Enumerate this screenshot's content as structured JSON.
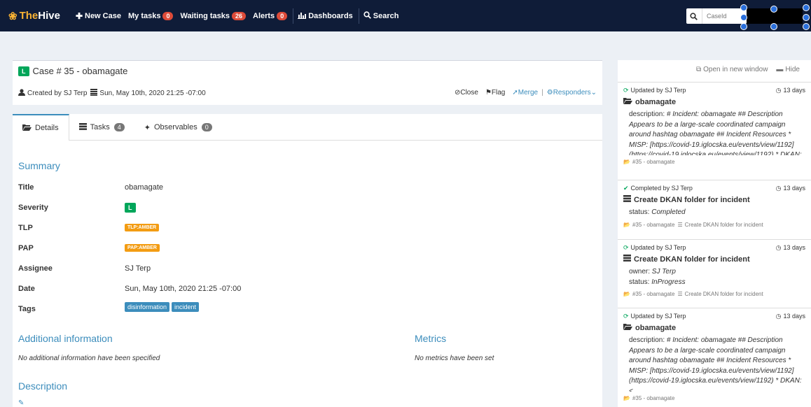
{
  "nav": {
    "brand_part1": "The",
    "brand_part2": "Hive",
    "new_case": "New Case",
    "my_tasks": "My tasks",
    "my_tasks_count": "0",
    "waiting_tasks": "Waiting tasks",
    "waiting_tasks_count": "26",
    "alerts": "Alerts",
    "alerts_count": "0",
    "dashboards": "Dashboards",
    "search": "Search",
    "search_placeholder": "CaseId"
  },
  "case": {
    "severity_badge": "L",
    "title": "Case # 35 - obamagate",
    "created_by": "Created by SJ Terp",
    "created_date": "Sun, May 10th, 2020 21:25 -07:00",
    "action_close": "Close",
    "action_flag": "Flag",
    "action_merge": "Merge",
    "action_responders": "Responders"
  },
  "tabs": [
    {
      "label": "Details"
    },
    {
      "label": "Tasks",
      "count": "4"
    },
    {
      "label": "Observables",
      "count": "0"
    }
  ],
  "summary": {
    "heading": "Summary",
    "title_label": "Title",
    "title_value": "obamagate",
    "severity_label": "Severity",
    "severity_value": "L",
    "tlp_label": "TLP",
    "tlp_value": "TLP:AMBER",
    "pap_label": "PAP",
    "pap_value": "PAP:AMBER",
    "assignee_label": "Assignee",
    "assignee_value": "SJ Terp",
    "date_label": "Date",
    "date_value": "Sun, May 10th, 2020 21:25 -07:00",
    "tags_label": "Tags",
    "tags": [
      "disinformation",
      "incident"
    ]
  },
  "additional": {
    "heading": "Additional information",
    "note": "No additional information have been specified"
  },
  "metrics": {
    "heading": "Metrics",
    "note": "No metrics have been set"
  },
  "description": {
    "heading": "Description"
  },
  "side": {
    "open_window": "Open in new window",
    "hide": "Hide",
    "items": [
      {
        "actor": "Updated by SJ Terp",
        "age": "13 days",
        "title": "obamagate",
        "field1_label": "description:",
        "field1_value": "# Incident: obamagate ## Description Appears to be a large-scale coordinated campaign around hashtag obamagate ## Incident Resources * MISP: [https://covid-19.iglocska.eu/events/view/1192](https://covid-19.iglocska.eu/events/view/1192) * DKAN: [",
        "foot": "#35 - obamagate"
      },
      {
        "actor": "Completed by SJ Terp",
        "age": "13 days",
        "title": "Create DKAN folder for incident",
        "field1_label": "status:",
        "field1_value": "Completed",
        "foot": "#35 - obamagate",
        "foot_task": "Create DKAN folder for incident"
      },
      {
        "actor": "Updated by SJ Terp",
        "age": "13 days",
        "title": "Create DKAN folder for incident",
        "field1_label": "owner:",
        "field1_value": "SJ Terp",
        "field2_label": "status:",
        "field2_value": "InProgress",
        "foot": "#35 - obamagate",
        "foot_task": "Create DKAN folder for incident"
      },
      {
        "actor": "Updated by SJ Terp",
        "age": "13 days",
        "title": "obamagate",
        "field1_label": "description:",
        "field1_value": "# Incident: obamagate ## Description Appears to be a large-scale coordinated campaign around hashtag obamagate ## Incident Resources * MISP: [https://covid-19.iglocska.eu/events/view/1192](https://covid-19.iglocska.eu/events/view/1192) * DKAN: <",
        "foot": "#35 - obamagate"
      }
    ]
  }
}
